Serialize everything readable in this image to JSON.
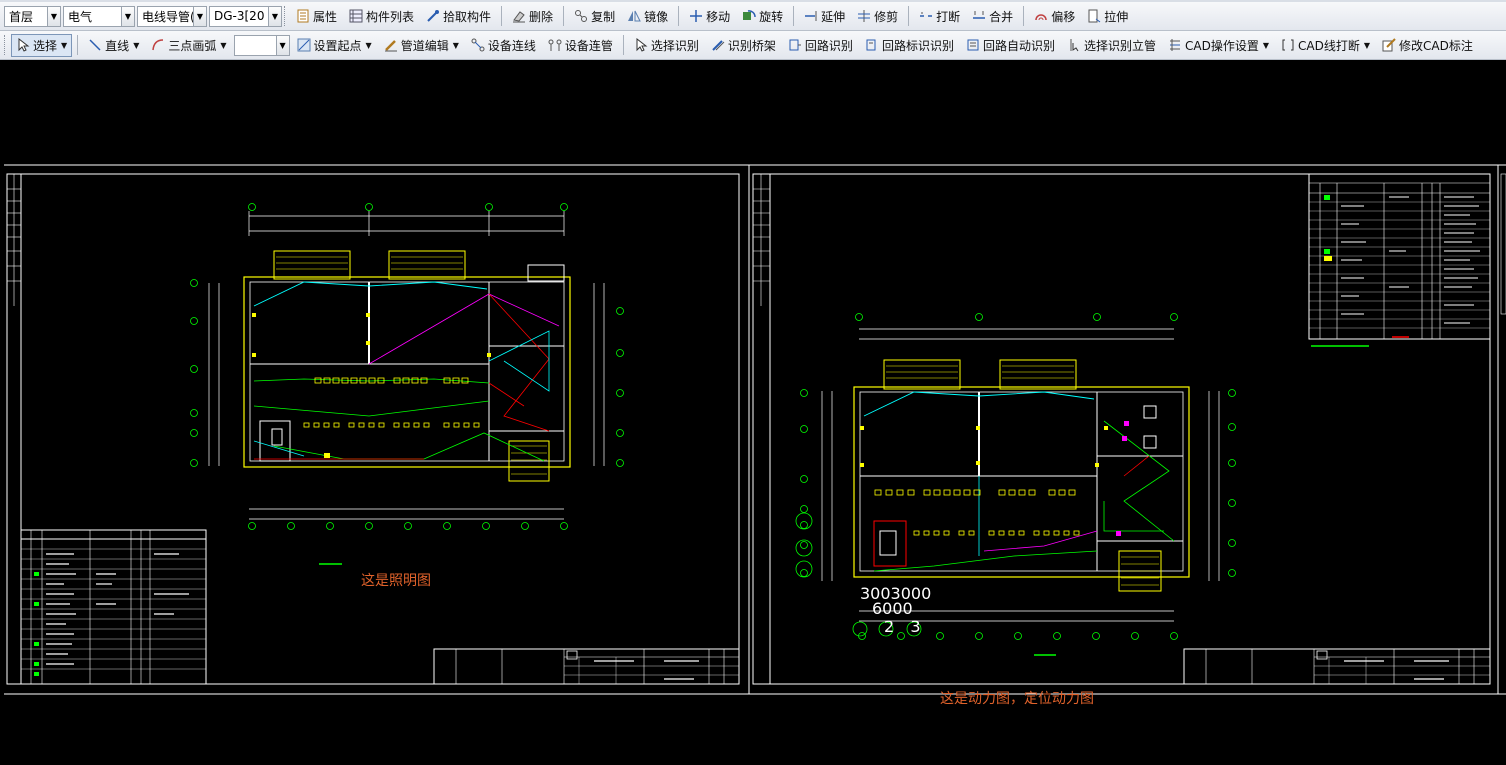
{
  "toolbar1": {
    "floor": "首层",
    "discipline": "电气",
    "component_type": "电线导管(",
    "component": "DG-3[20",
    "buttons": {
      "properties": "属性",
      "component_list": "构件列表",
      "pick_component": "拾取构件",
      "delete": "删除",
      "copy": "复制",
      "mirror": "镜像",
      "move": "移动",
      "rotate": "旋转",
      "extend": "延伸",
      "trim": "修剪",
      "break": "打断",
      "merge": "合并",
      "offset": "偏移",
      "stretch": "拉伸"
    }
  },
  "toolbar2": {
    "select": "选择",
    "line": "直线",
    "arc": "三点画弧",
    "set_start": "设置起点",
    "pipe_edit": "管道编辑",
    "device_connect": "设备连线",
    "device_pipe": "设备连管",
    "select_identify": "选择识别",
    "identify_tray": "识别桥架",
    "circuit_identify": "回路识别",
    "circuit_label_identify": "回路标识识别",
    "circuit_auto_identify": "回路自动识别",
    "select_identify_riser": "选择识别立管",
    "cad_settings": "CAD操作设置",
    "cad_break": "CAD线打断",
    "modify_cad_label": "修改CAD标注"
  },
  "canvas": {
    "left_note": "这是照明图",
    "right_note": "这是动力图，定位动力图",
    "overlay_numbers_line1": "3003000",
    "overlay_numbers_line2": "6000",
    "overlay_numbers_line3": "2  3"
  },
  "colors": {
    "background": "#000000",
    "cad_white": "#ffffff",
    "cad_yellow": "#ffff00",
    "cad_green": "#00ff00",
    "cad_red": "#ff0000",
    "cad_cyan": "#00ffff",
    "cad_magenta": "#ff00ff",
    "note_orange": "#e0622b"
  }
}
